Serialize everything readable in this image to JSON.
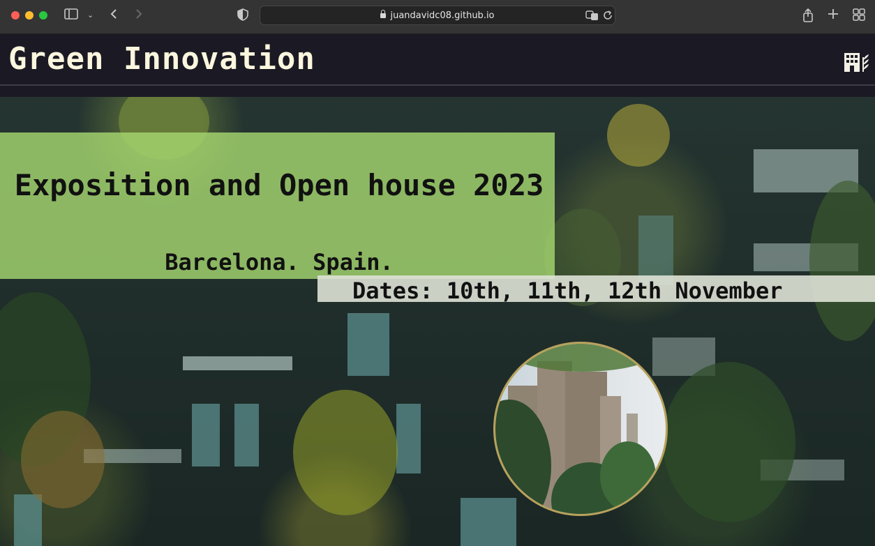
{
  "browser": {
    "url": "juandavidc08.github.io",
    "traffic_lights": [
      "#ff5f57",
      "#febc2e",
      "#28c840"
    ]
  },
  "header": {
    "title": "Green Innovation",
    "logo_icon": "building-leaf-icon",
    "background": "#1b1a24",
    "title_color": "#fbf6de"
  },
  "hero": {
    "title": "Exposition and Open house 2023",
    "city": "Barcelona. Spain.",
    "dates": "Dates: 10th, 11th, 12th November",
    "banner_color": "#a5d66f",
    "circle_image": "sagrada-familia-photo"
  }
}
